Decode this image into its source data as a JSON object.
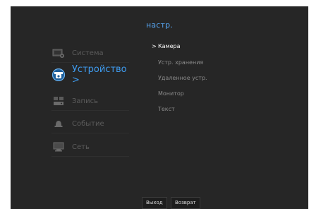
{
  "title": "настр.",
  "menu": {
    "items": [
      {
        "label": "Система",
        "icon": "system-settings-icon"
      },
      {
        "label": "Устройство >",
        "icon": "camera-device-icon"
      },
      {
        "label": "Запись",
        "icon": "recorder-icon"
      },
      {
        "label": "Событие",
        "icon": "event-bell-icon"
      },
      {
        "label": "Сеть",
        "icon": "network-monitor-icon"
      }
    ],
    "active_index": 1
  },
  "submenu": {
    "items": [
      {
        "label": "Камера",
        "marker": ">"
      },
      {
        "label": "Устр. хранения"
      },
      {
        "label": "Удаленное устр."
      },
      {
        "label": "Монитор"
      },
      {
        "label": "Текст"
      }
    ],
    "active_index": 0
  },
  "buttons": {
    "exit_label": "Выход",
    "back_label": "Возврат"
  },
  "colors": {
    "accent": "#3f9cf0",
    "background": "#262626",
    "inactive_text": "#5c5c5c"
  }
}
